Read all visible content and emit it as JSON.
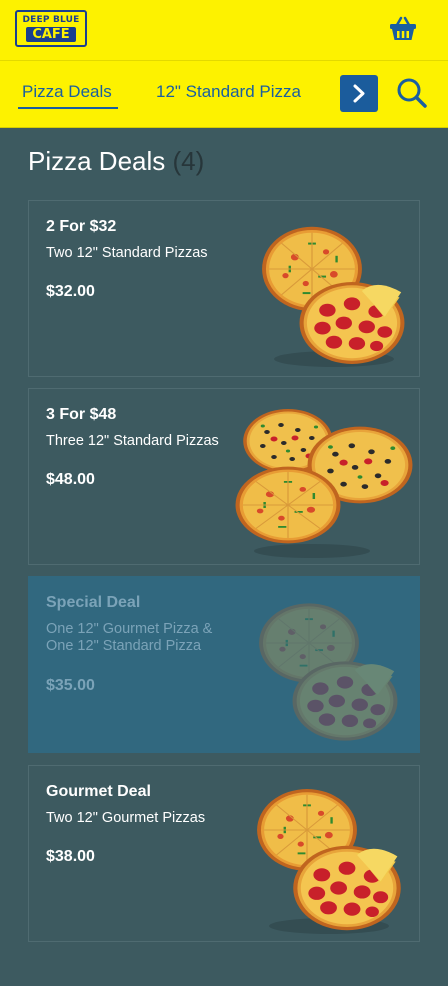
{
  "brand": {
    "logo_line1": "DEEP BLUE",
    "logo_line2": "CAFE"
  },
  "colors": {
    "header_bg": "#fdf200",
    "page_bg": "#3d5a60",
    "accent": "#1b5c9c",
    "disabled_card_bg": "#31687f"
  },
  "icons": {
    "cart": "basket-icon",
    "next": "chevron-right-icon",
    "search": "search-icon"
  },
  "tabs": [
    {
      "label": "Pizza Deals",
      "active": true
    },
    {
      "label": "12\" Standard Pizza",
      "active": false
    }
  ],
  "section": {
    "title": "Pizza Deals",
    "count": "(4)"
  },
  "deals": [
    {
      "name": "2 For $32",
      "description": "Two 12\" Standard Pizzas",
      "price": "$32.00",
      "available": true
    },
    {
      "name": "3 For $48",
      "description": "Three 12\" Standard Pizzas",
      "price": "$48.00",
      "available": true
    },
    {
      "name": "Special Deal",
      "description": "One 12\" Gourmet Pizza & One 12\" Standard Pizza",
      "price": "$35.00",
      "available": false
    },
    {
      "name": "Gourmet Deal",
      "description": "Two 12\" Gourmet Pizzas",
      "price": "$38.00",
      "available": true
    }
  ]
}
